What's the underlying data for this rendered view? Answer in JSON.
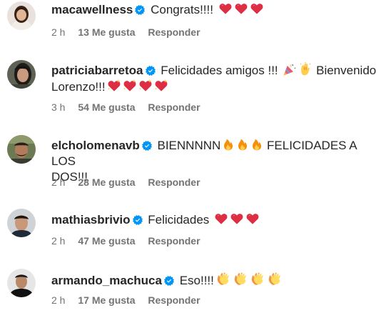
{
  "comments": [
    {
      "username": "macawellness",
      "text": "Congrats!!!!",
      "time": "2 h",
      "likes": "13 Me gusta",
      "reply": "Responder"
    },
    {
      "username": "patriciabarretoa",
      "text_part1": "Felicidades amigos !!!",
      "text_part2": "Bienvenido",
      "text_line2": "Lorenzo!!!",
      "time": "3 h",
      "likes": "54 Me gusta",
      "reply": "Responder"
    },
    {
      "username": "elcholomenavb",
      "text_part1": "BIENNNNN",
      "text_part2": "FELICIDADES A LOS",
      "text_line2": "DOS!!!",
      "time": "2 h",
      "likes": "28 Me gusta",
      "reply": "Responder"
    },
    {
      "username": "mathiasbrivio",
      "text": "Felicidades",
      "time": "2 h",
      "likes": "47 Me gusta",
      "reply": "Responder"
    },
    {
      "username": "armando_machuca",
      "text": "Eso!!!!",
      "time": "2 h",
      "likes": "17 Me gusta",
      "reply": "Responder"
    }
  ],
  "icons": {
    "verified": "verified-badge-icon",
    "heart": "red-heart-icon",
    "heart_sparkle": "sparkling-heart-icon",
    "party": "party-popper-icon",
    "hands": "raising-hands-icon",
    "fire": "fire-icon",
    "clap": "clapping-hands-icon"
  },
  "colors": {
    "verified": "#0095f6",
    "heart": "#e0245e",
    "fire": "#f4900c",
    "clap": "#ffcc4d",
    "meta_text": "#737373",
    "primary_text": "#262626"
  }
}
